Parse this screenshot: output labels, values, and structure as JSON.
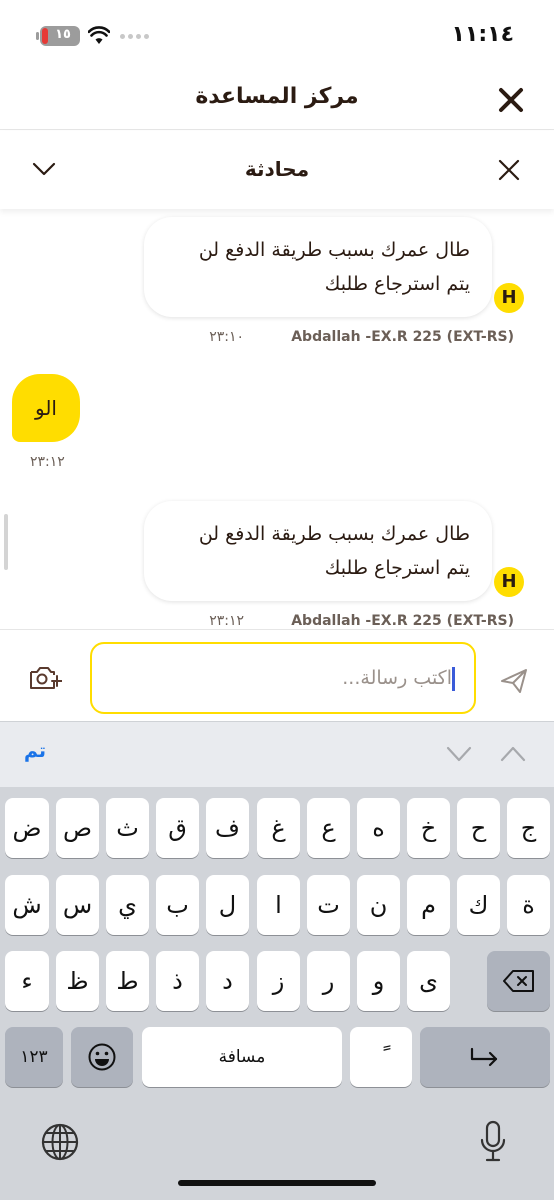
{
  "status_bar": {
    "time": "١١:١٤",
    "battery": "١٥"
  },
  "header": {
    "title": "مركز المساعدة"
  },
  "conversation": {
    "title": "محادثة"
  },
  "messages": [
    {
      "sender": "agent",
      "avatar": "H",
      "line1": "طال عمرك بسبب طريقة الدفع لن",
      "line2": "يتم استرجاع طلبك",
      "name": "Abdallah -EX.R 225 (EXT-RS)",
      "time": "٢٣:١٠"
    },
    {
      "sender": "user",
      "text": "الو",
      "time": "٢٣:١٢"
    },
    {
      "sender": "agent",
      "avatar": "H",
      "line1": "طال عمرك بسبب طريقة الدفع لن",
      "line2": "يتم استرجاع طلبك",
      "name": "Abdallah -EX.R 225 (EXT-RS)",
      "time": "٢٣:١٢"
    }
  ],
  "composer": {
    "placeholder": "اكتب رسالة..."
  },
  "keyboard": {
    "done_label": "تم",
    "row1": [
      "ج",
      "ح",
      "خ",
      "ه",
      "ع",
      "غ",
      "ف",
      "ق",
      "ث",
      "ص",
      "ض"
    ],
    "row2": [
      "ة",
      "ك",
      "م",
      "ن",
      "ت",
      "ا",
      "ل",
      "ب",
      "ي",
      "س",
      "ش"
    ],
    "row3": [
      "ى",
      "و",
      "ر",
      "ز",
      "د",
      "ذ",
      "ط",
      "ظ",
      "ء"
    ],
    "numbers_label": "١٢٣",
    "space_label": "مسافة",
    "tanween_label": "ً"
  },
  "colors": {
    "accent": "#ffdd00",
    "brown": "#2b1b12",
    "link": "#1a73e8"
  },
  "icons": [
    "close-icon",
    "chevron-down-icon",
    "camera-add-icon",
    "send-icon",
    "backspace-icon",
    "return-icon",
    "emoji-icon",
    "globe-icon",
    "microphone-icon",
    "wifi-icon"
  ]
}
